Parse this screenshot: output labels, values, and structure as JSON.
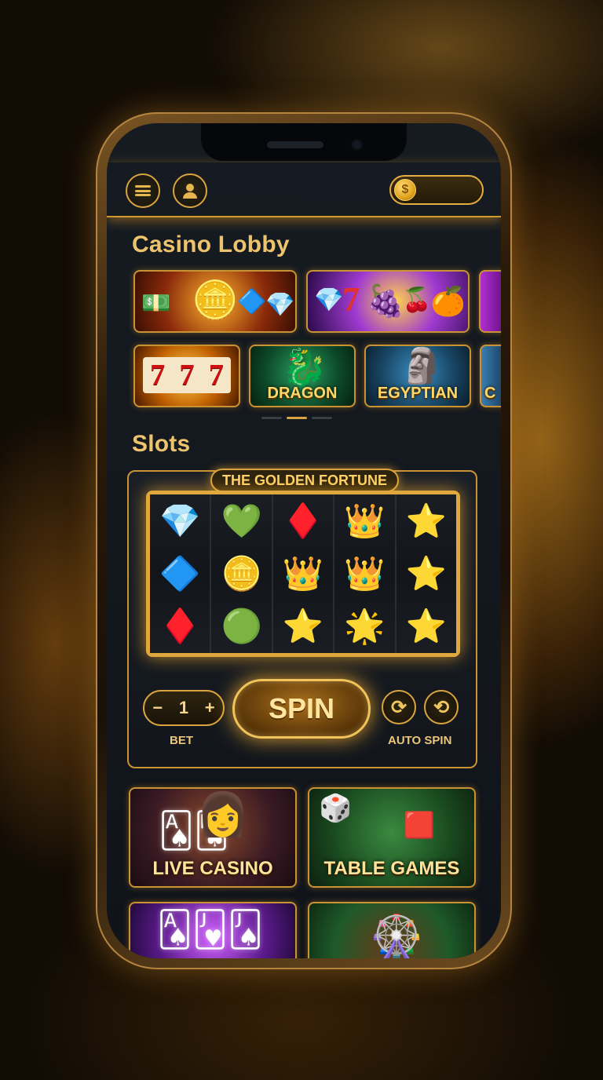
{
  "header": {
    "menu_icon": "hamburger-menu-icon",
    "profile_icon": "user-icon",
    "coin_symbol": "$"
  },
  "lobby": {
    "title": "Casino Lobby",
    "row1": [
      {
        "name": "Golden Treasures"
      },
      {
        "name": "Fruits & Gems"
      },
      {
        "name": "Purple Slot"
      }
    ],
    "row2": [
      {
        "symbols": [
          "7",
          "7",
          "7"
        ]
      },
      {
        "label": "DRAGON"
      },
      {
        "label": "EGYPTIAN"
      },
      {
        "label": "C"
      }
    ]
  },
  "slots": {
    "title": "Slots",
    "machine_title": "THE GOLDEN FORTUNE",
    "reels": [
      [
        "💎",
        "🔷",
        "♦️"
      ],
      [
        "💚",
        "🪙",
        "🟢"
      ],
      [
        "♦️",
        "👑",
        "⭐"
      ],
      [
        "👑",
        "👑",
        "🌟"
      ],
      [
        "⭐",
        "⭐",
        "⭐"
      ]
    ],
    "bet": {
      "minus": "−",
      "value": "1",
      "plus": "+",
      "label": "BET"
    },
    "spin_label": "SPIN",
    "auto_spin_label": "AUTO SPIN"
  },
  "games": [
    {
      "label": "LIVE CASINO"
    },
    {
      "label": "TABLE GAMES"
    },
    {
      "label": ""
    },
    {
      "label": ""
    }
  ],
  "colors": {
    "gold": "#d9a440",
    "accent": "#ffd36a",
    "background": "#120c05"
  }
}
